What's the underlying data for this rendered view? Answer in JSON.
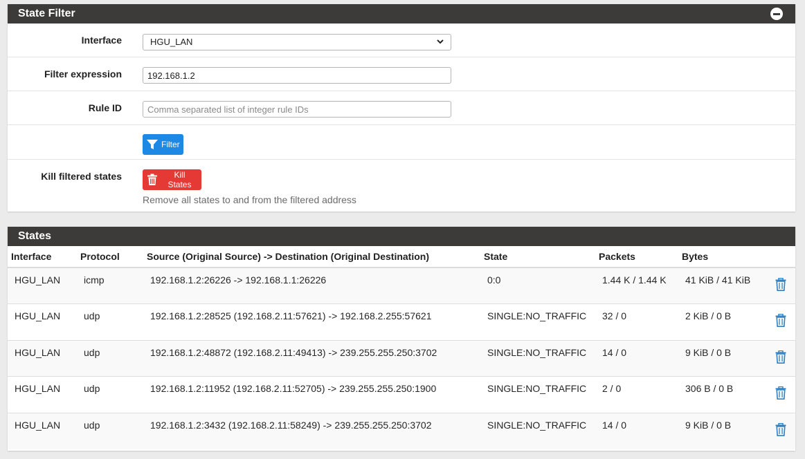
{
  "filter_panel": {
    "title": "State Filter",
    "interface_label": "Interface",
    "interface_value": "HGU_LAN",
    "filter_expression_label": "Filter expression",
    "filter_expression_value": "192.168.1.2",
    "rule_id_label": "Rule ID",
    "rule_id_placeholder": "Comma separated list of integer rule IDs",
    "filter_button_label": "Filter",
    "kill_label": "Kill filtered states",
    "kill_button_label": "Kill States",
    "kill_help": "Remove all states to and from the filtered address"
  },
  "states_panel": {
    "title": "States",
    "columns": [
      "Interface",
      "Protocol",
      "Source (Original Source) -> Destination (Original Destination)",
      "State",
      "Packets",
      "Bytes",
      ""
    ],
    "rows": [
      {
        "interface": "HGU_LAN",
        "protocol": "icmp",
        "connection": "192.168.1.2:26226 -> 192.168.1.1:26226",
        "state": "0:0",
        "packets": "1.44 K / 1.44 K",
        "bytes": "41 KiB / 41 KiB"
      },
      {
        "interface": "HGU_LAN",
        "protocol": "udp",
        "connection": "192.168.1.2:28525 (192.168.2.11:57621) -> 192.168.2.255:57621",
        "state": "SINGLE:NO_TRAFFIC",
        "packets": "32 / 0",
        "bytes": "2 KiB / 0 B"
      },
      {
        "interface": "HGU_LAN",
        "protocol": "udp",
        "connection": "192.168.1.2:48872 (192.168.2.11:49413) -> 239.255.255.250:3702",
        "state": "SINGLE:NO_TRAFFIC",
        "packets": "14 / 0",
        "bytes": "9 KiB / 0 B"
      },
      {
        "interface": "HGU_LAN",
        "protocol": "udp",
        "connection": "192.168.1.2:11952 (192.168.2.11:52705) -> 239.255.255.250:1900",
        "state": "SINGLE:NO_TRAFFIC",
        "packets": "2 / 0",
        "bytes": "306 B / 0 B"
      },
      {
        "interface": "HGU_LAN",
        "protocol": "udp",
        "connection": "192.168.1.2:3432 (192.168.2.11:58249) -> 239.255.255.250:3702",
        "state": "SINGLE:NO_TRAFFIC",
        "packets": "14 / 0",
        "bytes": "9 KiB / 0 B"
      }
    ]
  },
  "colors": {
    "header_bg": "#3c3b39",
    "filter_button": "#1e88e5",
    "kill_button": "#e53935",
    "trash_icon": "#2f7fc1"
  },
  "icons": {
    "collapse": "minus-circle-icon",
    "filter": "funnel-icon",
    "kill": "trash-icon",
    "row_action": "trash-icon",
    "select_caret": "chevron-down-icon"
  }
}
